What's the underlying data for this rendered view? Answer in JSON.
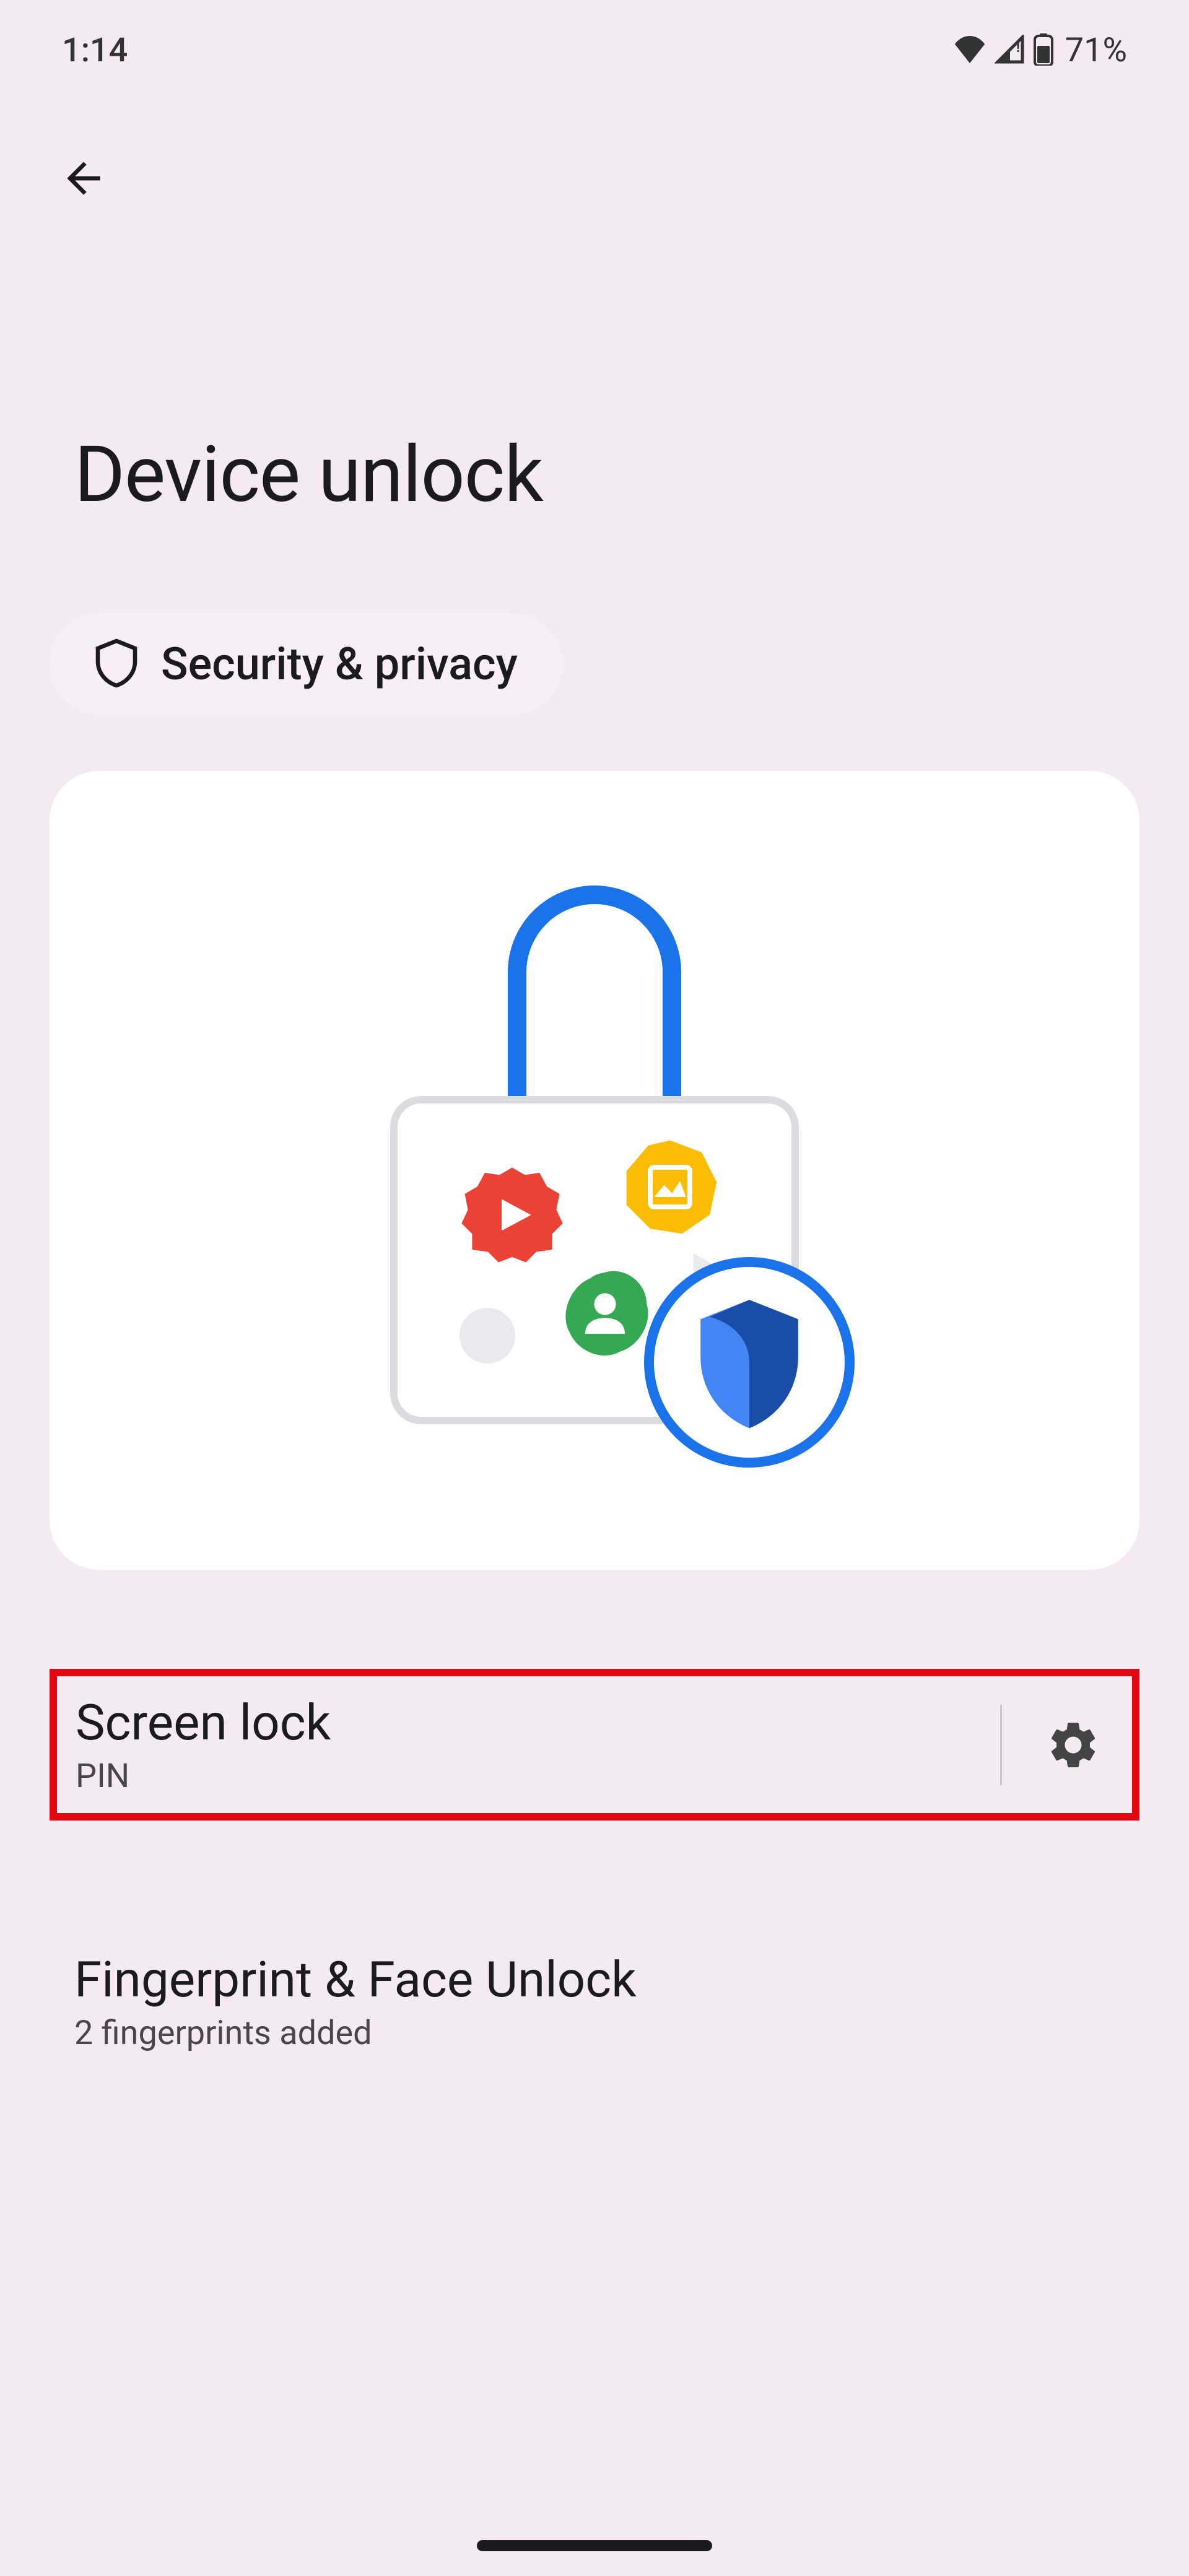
{
  "status": {
    "time": "1:14",
    "battery_pct": "71%"
  },
  "header": {
    "title": "Device unlock"
  },
  "chip": {
    "label": "Security & privacy"
  },
  "settings": [
    {
      "title": "Screen lock",
      "subtitle": "PIN",
      "highlighted": true,
      "has_cog": true
    },
    {
      "title": "Fingerprint & Face Unlock",
      "subtitle": "2 fingerprints added",
      "highlighted": false,
      "has_cog": false
    }
  ],
  "icons": {
    "back": "back-arrow",
    "shield_outline": "shield-outline",
    "wifi": "wifi",
    "cellular": "cellular",
    "battery": "battery",
    "gear": "gear"
  }
}
